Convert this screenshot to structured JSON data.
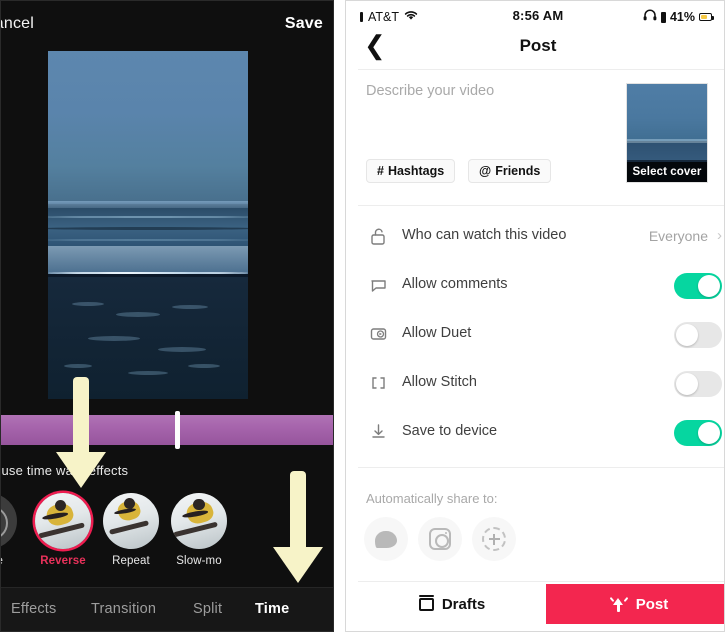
{
  "editor": {
    "cancel_label": "Cancel",
    "save_label": "Save",
    "hint_text": "…o use time warp effects",
    "effects": [
      {
        "label": "None",
        "selected": false,
        "icon": "none-circle-icon"
      },
      {
        "label": "Reverse",
        "selected": true,
        "icon": "skier-thumbnail"
      },
      {
        "label": "Repeat",
        "selected": false,
        "icon": "skier-thumbnail"
      },
      {
        "label": "Slow-mo",
        "selected": false,
        "icon": "skier-thumbnail"
      }
    ],
    "tabs": [
      {
        "label": "Effects",
        "active": false
      },
      {
        "label": "Transition",
        "active": false
      },
      {
        "label": "Split",
        "active": false
      },
      {
        "label": "Time",
        "active": true
      }
    ],
    "annotations": [
      {
        "name": "arrow-pointing-to-timeline",
        "color": "#f7f3c8"
      },
      {
        "name": "arrow-pointing-to-time-tab",
        "color": "#f7f3c8"
      }
    ]
  },
  "post": {
    "status_bar": {
      "carrier": "AT&T",
      "wifi_icon": "wifi-icon",
      "time": "8:56 AM",
      "headphones_icon": "headphones-icon",
      "battery_percent": "41%"
    },
    "nav": {
      "back_icon": "chevron-left-icon",
      "title": "Post"
    },
    "description": {
      "placeholder": "Describe your video",
      "value": ""
    },
    "chips": [
      {
        "label": "Hashtags",
        "glyph": "#",
        "icon": "hashtag-icon"
      },
      {
        "label": "Friends",
        "glyph": "@",
        "icon": "at-mention-icon"
      }
    ],
    "cover": {
      "label": "Select cover"
    },
    "settings": [
      {
        "label": "Who can watch this video",
        "icon": "unlock-icon",
        "type": "value",
        "value": "Everyone",
        "chevron": "›"
      },
      {
        "label": "Allow comments",
        "icon": "comment-bubble-icon",
        "type": "toggle",
        "on": true
      },
      {
        "label": "Allow Duet",
        "icon": "duet-icon",
        "type": "toggle",
        "on": false
      },
      {
        "label": "Allow Stitch",
        "icon": "stitch-icon",
        "type": "toggle",
        "on": false
      },
      {
        "label": "Save to device",
        "icon": "download-icon",
        "type": "toggle",
        "on": true
      }
    ],
    "auto_share_label": "Automatically share to:",
    "share_targets": [
      {
        "name": "message-bubble-icon"
      },
      {
        "name": "instagram-icon"
      },
      {
        "name": "add-more-icon"
      }
    ],
    "actions": {
      "drafts_label": "Drafts",
      "drafts_icon": "drafts-icon",
      "post_label": "Post",
      "post_icon": "post-upload-icon"
    }
  },
  "colors": {
    "accent_red": "#f3264f",
    "toggle_on_green": "#06d6a0",
    "timeline_purple": "#a563ab",
    "annotation_yellow": "#f7f3c8",
    "selected_effect_ring": "#ee1d50"
  }
}
